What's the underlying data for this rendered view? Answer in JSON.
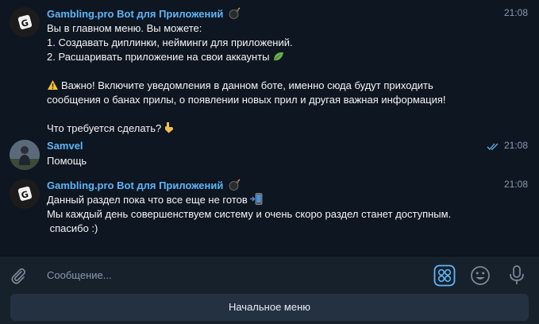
{
  "messages": [
    {
      "sender": "Gambling.pro Bot для Приложений",
      "time": "21:08",
      "lines": [
        "Вы в главном меню. Вы можете:",
        "1. Создавать диплинки, нейминги для приложений.",
        "2. Расшаривать приложение на свои аккаунты",
        "",
        "Важно! Включите уведомления в данном боте, именно сюда будут приходить",
        "сообщения о банах прилы, о появлении новых прил и другая важная информация!",
        "",
        "Что требуется сделать?"
      ]
    },
    {
      "sender": "Samvel",
      "time": "21:08",
      "lines": [
        "Помощь"
      ]
    },
    {
      "sender": "Gambling.pro Bot для Приложений",
      "time": "21:08",
      "lines": [
        "Данный раздел пока что все еще не готов",
        "Мы каждый день совершенствуем систему и очень скоро раздел станет доступным.",
        " спасибо :)"
      ]
    }
  ],
  "composer": {
    "placeholder": "Сообщение..."
  },
  "keyboard": {
    "button_label": "Начальное меню"
  },
  "colors": {
    "accent": "#5eb5f7",
    "background": "#0e1621",
    "panel": "#17212b"
  }
}
